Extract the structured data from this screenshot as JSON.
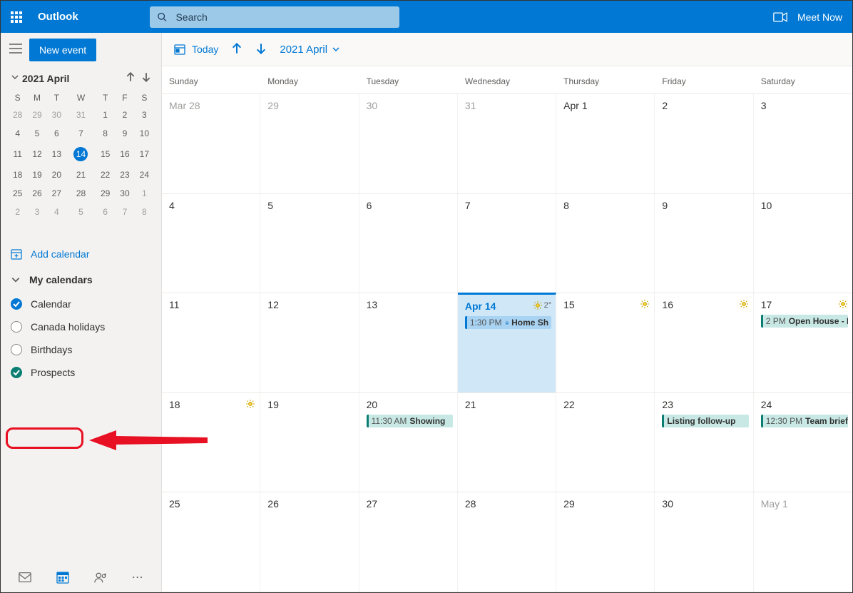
{
  "header": {
    "app_title": "Outlook",
    "search_placeholder": "Search",
    "meet_now": "Meet Now"
  },
  "sidebar": {
    "new_event": "New event",
    "mini_cal": {
      "title": "2021 April",
      "dow": [
        "S",
        "M",
        "T",
        "W",
        "T",
        "F",
        "S"
      ],
      "rows": [
        [
          {
            "n": "28",
            "dim": true
          },
          {
            "n": "29",
            "dim": true
          },
          {
            "n": "30",
            "dim": true
          },
          {
            "n": "31",
            "dim": true
          },
          {
            "n": "1"
          },
          {
            "n": "2"
          },
          {
            "n": "3"
          }
        ],
        [
          {
            "n": "4"
          },
          {
            "n": "5"
          },
          {
            "n": "6"
          },
          {
            "n": "7"
          },
          {
            "n": "8"
          },
          {
            "n": "9"
          },
          {
            "n": "10"
          }
        ],
        [
          {
            "n": "11"
          },
          {
            "n": "12"
          },
          {
            "n": "13"
          },
          {
            "n": "14",
            "today": true
          },
          {
            "n": "15"
          },
          {
            "n": "16"
          },
          {
            "n": "17"
          }
        ],
        [
          {
            "n": "18"
          },
          {
            "n": "19"
          },
          {
            "n": "20"
          },
          {
            "n": "21"
          },
          {
            "n": "22"
          },
          {
            "n": "23"
          },
          {
            "n": "24"
          }
        ],
        [
          {
            "n": "25"
          },
          {
            "n": "26"
          },
          {
            "n": "27"
          },
          {
            "n": "28"
          },
          {
            "n": "29"
          },
          {
            "n": "30"
          },
          {
            "n": "1",
            "dim": true
          }
        ],
        [
          {
            "n": "2",
            "dim": true
          },
          {
            "n": "3",
            "dim": true
          },
          {
            "n": "4",
            "dim": true
          },
          {
            "n": "5",
            "dim": true
          },
          {
            "n": "6",
            "dim": true
          },
          {
            "n": "7",
            "dim": true
          },
          {
            "n": "8",
            "dim": true
          }
        ]
      ]
    },
    "add_calendar": "Add calendar",
    "my_calendars": "My calendars",
    "calendars": [
      {
        "label": "Calendar",
        "checked": true,
        "color": "#0078D4"
      },
      {
        "label": "Canada holidays",
        "checked": false
      },
      {
        "label": "Birthdays",
        "checked": false
      },
      {
        "label": "Prospects",
        "checked": true,
        "color": "#0b7e74"
      }
    ]
  },
  "toolbar": {
    "today": "Today",
    "date": "2021 April"
  },
  "grid": {
    "dow": [
      "Sunday",
      "Monday",
      "Tuesday",
      "Wednesday",
      "Thursday",
      "Friday",
      "Saturday"
    ],
    "weeks": [
      [
        {
          "label": "Mar 28",
          "dim": true
        },
        {
          "label": "29",
          "dim": true
        },
        {
          "label": "30",
          "dim": true
        },
        {
          "label": "31",
          "dim": true
        },
        {
          "label": "Apr 1"
        },
        {
          "label": "2"
        },
        {
          "label": "3"
        }
      ],
      [
        {
          "label": "4"
        },
        {
          "label": "5"
        },
        {
          "label": "6"
        },
        {
          "label": "7"
        },
        {
          "label": "8"
        },
        {
          "label": "9"
        },
        {
          "label": "10"
        }
      ],
      [
        {
          "label": "11"
        },
        {
          "label": "12"
        },
        {
          "label": "13"
        },
        {
          "label": "Apr 14",
          "today": true,
          "weather": "2°",
          "events": [
            {
              "time": "1:30 PM",
              "title": "Home Sh",
              "style": "blue",
              "icon": "home"
            }
          ]
        },
        {
          "label": "15",
          "weather": ""
        },
        {
          "label": "16",
          "weather": ""
        },
        {
          "label": "17",
          "weather": "",
          "events": [
            {
              "time": "2 PM",
              "title": "Open House - P",
              "style": "teal"
            }
          ]
        }
      ],
      [
        {
          "label": "18",
          "weather": ""
        },
        {
          "label": "19"
        },
        {
          "label": "20",
          "events": [
            {
              "time": "11:30 AM",
              "title": "Showing",
              "style": "teal"
            }
          ]
        },
        {
          "label": "21"
        },
        {
          "label": "22"
        },
        {
          "label": "23",
          "events": [
            {
              "time": "",
              "title": "Listing follow-up",
              "style": "teal"
            }
          ]
        },
        {
          "label": "24",
          "events": [
            {
              "time": "12:30 PM",
              "title": "Team brief",
              "style": "teal"
            }
          ]
        }
      ],
      [
        {
          "label": "25"
        },
        {
          "label": "26"
        },
        {
          "label": "27"
        },
        {
          "label": "28"
        },
        {
          "label": "29"
        },
        {
          "label": "30"
        },
        {
          "label": "May 1",
          "dim": true
        }
      ]
    ]
  }
}
